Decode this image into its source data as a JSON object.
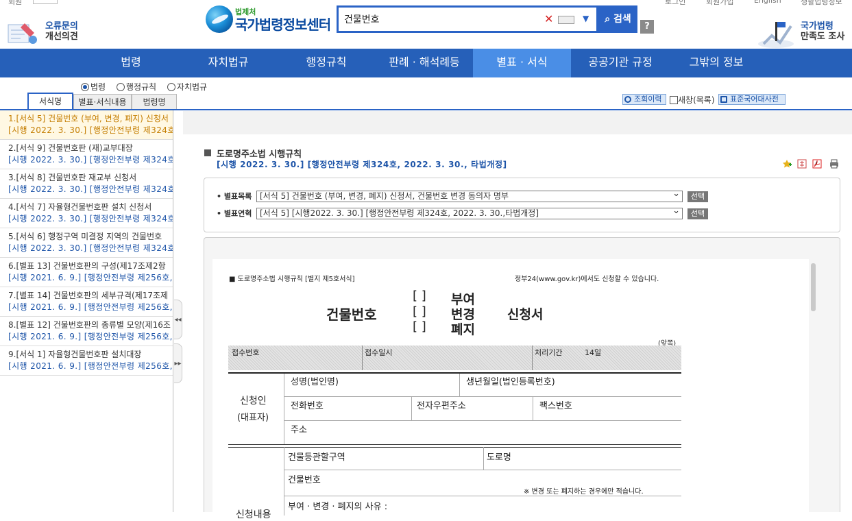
{
  "top_links": [
    "회원",
    "로그인",
    "회원가입",
    "English",
    "생활법령정보"
  ],
  "left_feedback": {
    "line1": "오류문의",
    "line2": "개선의견"
  },
  "logo": {
    "small": "법제처",
    "title": "국가법령정보센터"
  },
  "search": {
    "value": "건물번호",
    "clear": "✕",
    "button": "검색",
    "help": "?"
  },
  "right_survey": {
    "line1": "국가법령",
    "line2": "만족도 조사"
  },
  "nav": [
    "법령",
    "자치법규",
    "행정규칙",
    "판례 · 해석례등",
    "별표 · 서식",
    "공공기관 규정",
    "그밖의 정보"
  ],
  "radios": [
    "법령",
    "행정규칙",
    "자치법규"
  ],
  "tabs": [
    "서식명",
    "별표·서식내용",
    "법령명"
  ],
  "tools": {
    "history": "조회이력",
    "newwin": "새창(목록)",
    "dict": "표준국어대사전"
  },
  "results": [
    {
      "t1": "1.[서식 5] 건물번호 (부여, 변경, 폐지) 신청서",
      "t2": "[시행 2022. 3. 30.] [행정안전부령 제324호, 2"
    },
    {
      "t1": "2.[서식 9] 건물번호판 (재)교부대장",
      "t2": "[시행 2022. 3. 30.] [행정안전부령 제324호, 2"
    },
    {
      "t1": "3.[서식 8] 건물번호판 재교부 신청서",
      "t2": "[시행 2022. 3. 30.] [행정안전부령 제324호, 2"
    },
    {
      "t1": "4.[서식 7] 자율형건물번호판 설치 신청서",
      "t2": "[시행 2022. 3. 30.] [행정안전부령 제324호, 2"
    },
    {
      "t1": "5.[서식 6] 행정구역 미결정 지역의 건물번호",
      "t2": "[시행 2022. 3. 30.] [행정안전부령 제324호, 2"
    },
    {
      "t1": "6.[별표 13] 건물번호판의 구성(제17조제2항",
      "t2": "[시행 2021. 6. 9.] [행정안전부령 제256호, 20"
    },
    {
      "t1": "7.[별표 14] 건물번호판의 세부규격(제17조제",
      "t2": "[시행 2021. 6. 9.] [행정안전부령 제256호, 20"
    },
    {
      "t1": "8.[별표 12] 건물번호판의 종류별 모양(제16조",
      "t2": "[시행 2021. 6. 9.] [행정안전부령 제256호, 20"
    },
    {
      "t1": "9.[서식 1] 자율형건물번호판 설치대장",
      "t2": "[시행 2021. 6. 9.] [행정안전부령 제256호, 20"
    }
  ],
  "handles": {
    "collapse": "◂◂",
    "expand": "▸▸"
  },
  "law": {
    "title": "도로명주소법 시행규칙",
    "sub": "[시행 2022. 3. 30.] [행정안전부령 제324호, 2022. 3. 30., 타법개정]"
  },
  "selects": [
    {
      "label": "• 별표목록",
      "value": "[서식 5] 건물번호 (부여, 변경, 폐지) 신청서, 건물번호 변경 동의자 명부",
      "button": "선택"
    },
    {
      "label": "• 별표연혁",
      "value": "[서식 5] [시행2022. 3. 30.] [행정안전부령 제324호, 2022. 3. 30.,타법개정]",
      "button": "선택"
    }
  ],
  "doc": {
    "header_left": "■ 도로명주소법 시행규칙 [별지 제5호서식]",
    "header_right": "정부24(www.gov.kr)에서도 신청할 수 있습니다.",
    "title_left": "건물번호",
    "bracket_1": "[   ]",
    "bracket_2": "[   ]",
    "bracket_3": "[   ]",
    "opt_1": "부여",
    "opt_2": "변경",
    "opt_3": "폐지",
    "title_right": "신청서",
    "front": "(앞쪽)",
    "receipt_no": "접수번호",
    "receipt_date": "접수일시",
    "proc_period": "처리기간",
    "proc_days": "14일",
    "applicant": "신청인",
    "applicant_sub": "(대표자)",
    "name": "성명(법인명)",
    "birth": "생년월일(법인등록번호)",
    "phone": "전화번호",
    "email": "전자우편주소",
    "fax": "팩스번호",
    "address": "주소",
    "area": "건물등관할구역",
    "road": "도로명",
    "bldg_no": "건물번호",
    "note": "※ 변경 또는 폐지하는 경우에만 적습니다.",
    "reason": "부여 · 변경 · 폐지의 사유 :",
    "section2": "신청내용"
  }
}
